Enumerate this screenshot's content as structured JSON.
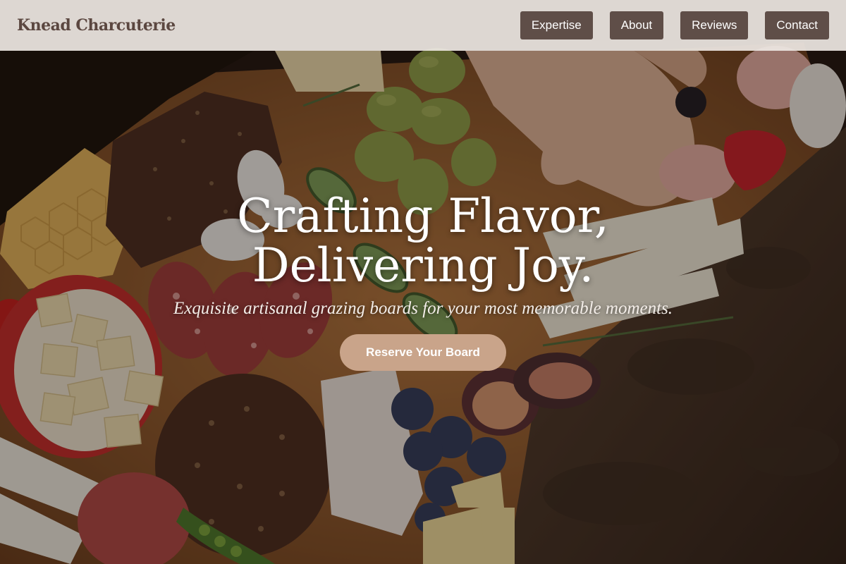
{
  "header": {
    "brand": "Knead Charcuterie",
    "nav": [
      {
        "label": "Expertise"
      },
      {
        "label": "About"
      },
      {
        "label": "Reviews"
      },
      {
        "label": "Contact"
      }
    ]
  },
  "hero": {
    "title_line1": "Crafting Flavor,",
    "title_line2": "Delivering Joy.",
    "subtitle": "Exquisite artisanal grazing boards for your most memorable moments.",
    "cta": "Reserve Your Board",
    "background_image": "charcuterie-board-photo"
  },
  "colors": {
    "header_bg": "#eee8e4",
    "brand_text": "#5b4740",
    "nav_button": "#5f4e48",
    "cta_button": "#c9a48a",
    "text_light": "#ffffff"
  }
}
